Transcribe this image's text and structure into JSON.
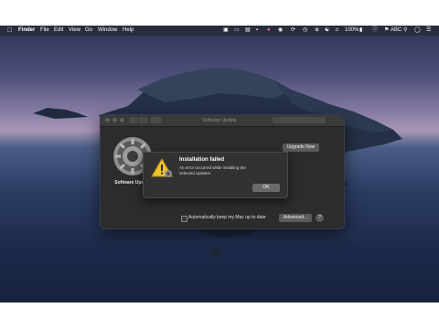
{
  "menubar": {
    "apple_icon": "apple-logo-icon",
    "items": [
      "Finder",
      "File",
      "Edit",
      "View",
      "Go",
      "Window",
      "Help"
    ],
    "battery": "100%",
    "input_source": "ABC"
  },
  "window": {
    "title": "Software Update",
    "sidebar_label": "Software Update",
    "upgrade_button": "Upgrade Now",
    "auto_update_label": "Automatically keep my Mac up to date",
    "advanced_button": "Advanced...",
    "help_button": "?"
  },
  "alert": {
    "title": "Installation failed",
    "message": "An error occurred while installing the selected updates.",
    "ok_button": "OK"
  }
}
